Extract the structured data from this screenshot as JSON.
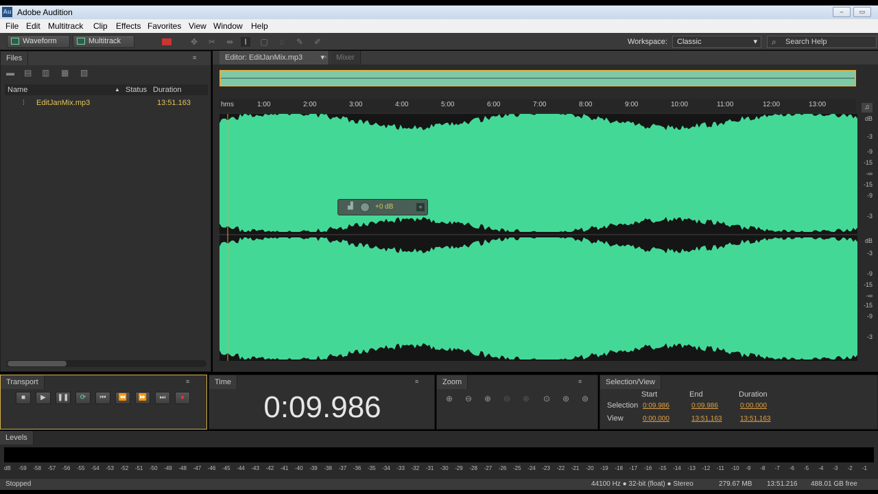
{
  "app": {
    "title": "Adobe Audition"
  },
  "menu": [
    "File",
    "Edit",
    "Multitrack",
    "Clip",
    "Effects",
    "Favorites",
    "View",
    "Window",
    "Help"
  ],
  "toolbar": {
    "waveform_label": "Waveform",
    "multitrack_label": "Multitrack",
    "workspace_label": "Workspace:",
    "workspace_value": "Classic",
    "search_placeholder": "Search Help"
  },
  "files": {
    "tab": "Files",
    "columns": {
      "name": "Name",
      "status": "Status",
      "duration": "Duration"
    },
    "items": [
      {
        "name": "EditJanMix.mp3",
        "duration": "13:51.163"
      }
    ]
  },
  "editor": {
    "tab": "Editor: EditJanMix.mp3",
    "mixer_tab": "Mixer",
    "ruler": [
      "hms",
      "1:00",
      "2:00",
      "3:00",
      "4:00",
      "5:00",
      "6:00",
      "7:00",
      "8:00",
      "9:00",
      "10:00",
      "11:00",
      "12:00",
      "13:00"
    ],
    "db_labels": [
      "dB",
      "-3",
      "-9",
      "-15",
      "-∞",
      "-15",
      "-9",
      "-3",
      "dB",
      "-3",
      "-9",
      "-15",
      "-∞",
      "-15",
      "-9",
      "-3"
    ],
    "hud_value": "+0 dB",
    "waveform_color": "#44d897"
  },
  "transport": {
    "tab": "Transport"
  },
  "time": {
    "tab": "Time",
    "value": "0:09.986"
  },
  "zoom": {
    "tab": "Zoom"
  },
  "selection_view": {
    "tab": "Selection/View",
    "headers": {
      "start": "Start",
      "end": "End",
      "duration": "Duration"
    },
    "selection": {
      "label": "Selection",
      "start": "0:09.986",
      "end": "0:09.986",
      "duration": "0:00.000"
    },
    "view": {
      "label": "View",
      "start": "0:00.000",
      "end": "13:51.163",
      "duration": "13:51.163"
    }
  },
  "levels": {
    "tab": "Levels",
    "scale": [
      "dB",
      "-59",
      "-58",
      "-57",
      "-56",
      "-55",
      "-54",
      "-53",
      "-52",
      "-51",
      "-50",
      "-49",
      "-48",
      "-47",
      "-46",
      "-45",
      "-44",
      "-43",
      "-42",
      "-41",
      "-40",
      "-39",
      "-38",
      "-37",
      "-36",
      "-35",
      "-34",
      "-33",
      "-32",
      "-31",
      "-30",
      "-29",
      "-28",
      "-27",
      "-26",
      "-25",
      "-24",
      "-23",
      "-22",
      "-21",
      "-20",
      "-19",
      "-18",
      "-17",
      "-16",
      "-15",
      "-14",
      "-13",
      "-12",
      "-11",
      "-10",
      "-9",
      "-8",
      "-7",
      "-6",
      "-5",
      "-4",
      "-3",
      "-2",
      "-1"
    ]
  },
  "status": {
    "state": "Stopped",
    "format": "44100 Hz ● 32-bit (float) ● Stereo",
    "size": "279.67 MB",
    "duration": "13:51.216",
    "free": "488.01 GB free"
  }
}
